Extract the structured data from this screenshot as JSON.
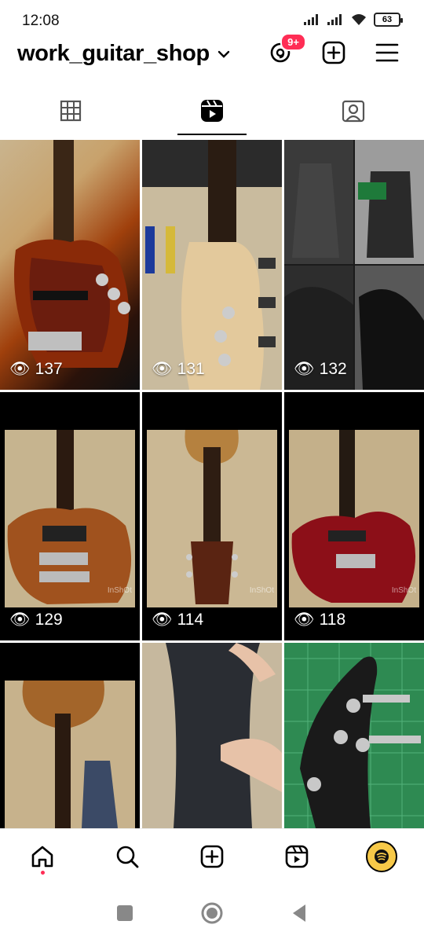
{
  "status": {
    "time": "12:08",
    "battery": "63"
  },
  "header": {
    "username": "work_guitar_shop",
    "notification_count": "9+"
  },
  "tabs": [
    {
      "name": "grid",
      "icon": "grid-icon",
      "active": false
    },
    {
      "name": "reels",
      "icon": "reels-icon",
      "active": true
    },
    {
      "name": "tagged",
      "icon": "tagged-icon",
      "active": false
    }
  ],
  "reels": [
    {
      "views": "137",
      "watermark": ""
    },
    {
      "views": "131",
      "watermark": ""
    },
    {
      "views": "132",
      "watermark": ""
    },
    {
      "views": "129",
      "watermark": "InShOt"
    },
    {
      "views": "114",
      "watermark": "InShOt"
    },
    {
      "views": "118",
      "watermark": "InShOt"
    },
    {
      "views": "",
      "watermark": ""
    },
    {
      "views": "",
      "watermark": ""
    },
    {
      "views": "",
      "watermark": ""
    }
  ],
  "bottom_nav": [
    {
      "name": "home",
      "icon": "home-icon"
    },
    {
      "name": "search",
      "icon": "search-icon"
    },
    {
      "name": "create",
      "icon": "create-icon"
    },
    {
      "name": "reels",
      "icon": "reels-icon"
    },
    {
      "name": "profile",
      "icon": "profile-avatar"
    }
  ],
  "colors": {
    "accent": "#ff2d55",
    "avatar": "#f7c948"
  }
}
